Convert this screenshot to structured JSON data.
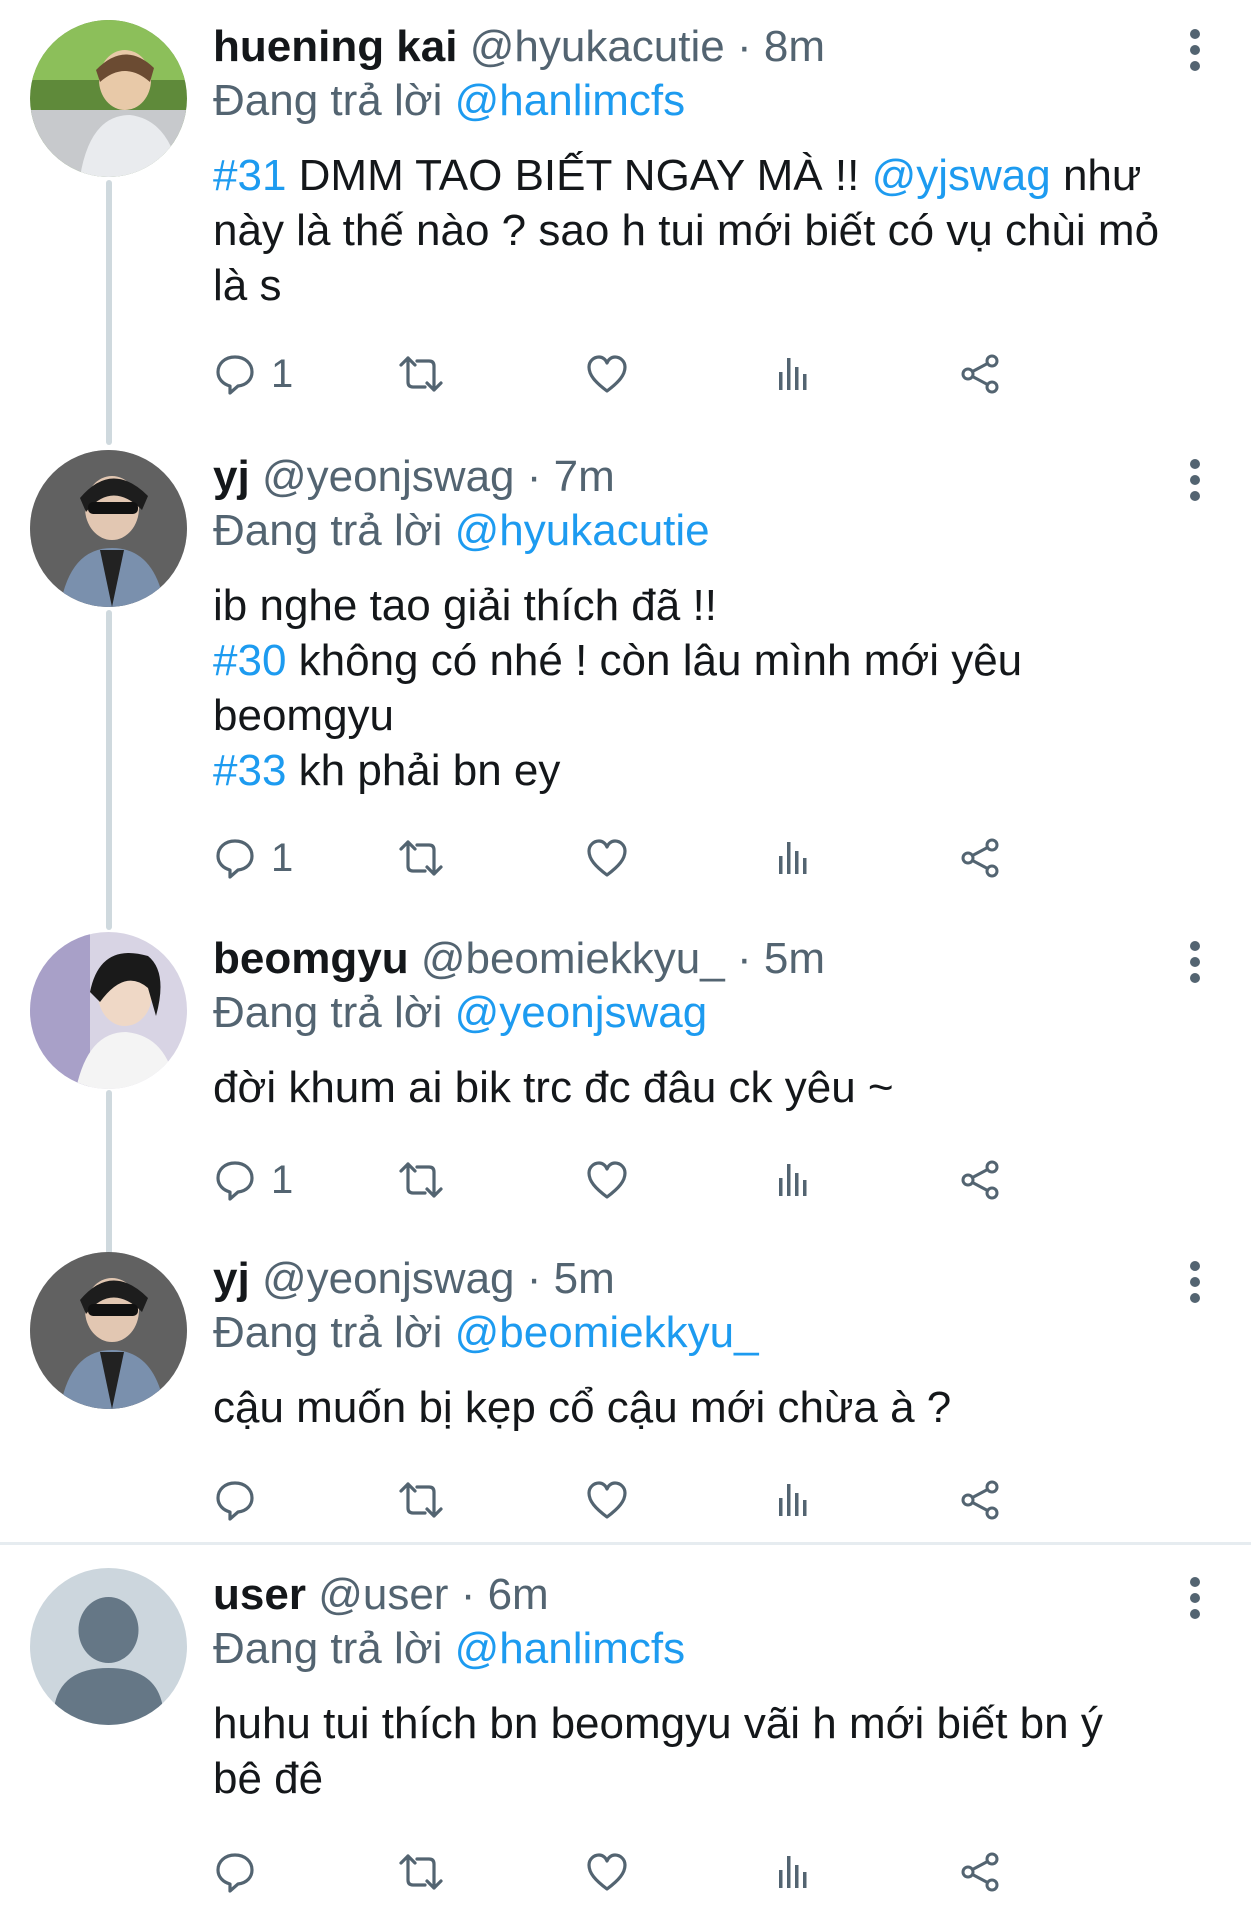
{
  "tweets": [
    {
      "display_name": "huening kai",
      "handle": "@hyukacutie",
      "separator": "·",
      "time": "8m",
      "reply_prefix": "Đang trả lời",
      "reply_to": "@hanlimcfs",
      "text_lines": [
        [
          {
            "t": "#31",
            "c": "tag"
          },
          {
            "t": " DMM TAO BIẾT NGAY MÀ !! ",
            "c": ""
          },
          {
            "t": "@yjswag",
            "c": "tag"
          },
          {
            "t": " như",
            "c": ""
          }
        ],
        [
          {
            "t": "này là thế nào ? sao h tui mới biết có vụ chùi mỏ",
            "c": ""
          }
        ],
        [
          {
            "t": "là s",
            "c": ""
          }
        ]
      ],
      "reply_count": "1",
      "avatar": "photo-blonde"
    },
    {
      "display_name": "yj",
      "handle": "@yeonjswag",
      "separator": "·",
      "time": "7m",
      "reply_prefix": "Đang trả lời",
      "reply_to": "@hyukacutie",
      "text_lines": [
        [
          {
            "t": "ib nghe tao giải thích đã !!",
            "c": ""
          }
        ],
        [
          {
            "t": "#30",
            "c": "tag"
          },
          {
            "t": " không có nhé ! còn lâu mình mới yêu",
            "c": ""
          }
        ],
        [
          {
            "t": "beomgyu",
            "c": ""
          }
        ],
        [
          {
            "t": "#33",
            "c": "tag"
          },
          {
            "t": " kh phải bn ey",
            "c": ""
          }
        ]
      ],
      "reply_count": "1",
      "avatar": "photo-sunglasses"
    },
    {
      "display_name": "beomgyu",
      "handle": "@beomiekkyu_",
      "separator": "·",
      "time": "5m",
      "reply_prefix": "Đang trả lời",
      "reply_to": "@yeonjswag",
      "text_lines": [
        [
          {
            "t": "đời khum ai bik trc đc đâu ck yêu ~",
            "c": ""
          }
        ]
      ],
      "reply_count": "1",
      "avatar": "photo-dark-hair"
    },
    {
      "display_name": "yj",
      "handle": "@yeonjswag",
      "separator": "·",
      "time": "5m",
      "reply_prefix": "Đang trả lời",
      "reply_to": "@beomiekkyu_",
      "text_lines": [
        [
          {
            "t": "cậu muốn bị kẹp cổ cậu mới chừa à ?",
            "c": ""
          }
        ]
      ],
      "reply_count": "",
      "avatar": "photo-sunglasses"
    },
    {
      "display_name": "user",
      "handle": "@user",
      "separator": "·",
      "time": "6m",
      "reply_prefix": "Đang trả lời",
      "reply_to": "@hanlimcfs",
      "text_lines": [
        [
          {
            "t": "huhu tui thích bn beomgyu vãi h mới biết bn ý",
            "c": ""
          }
        ],
        [
          {
            "t": "bê đê",
            "c": ""
          }
        ]
      ],
      "reply_count": "",
      "avatar": "default-avatar"
    }
  ],
  "colors": {
    "accent": "#1d9bf0",
    "secondary_text": "#536471",
    "thread_line": "#cfd9de",
    "divider": "#e6ecf0"
  },
  "icons": {
    "reply": "reply-icon",
    "retweet": "retweet-icon",
    "like": "like-icon",
    "views": "views-icon",
    "share": "share-icon",
    "more": "more-vertical-icon"
  }
}
